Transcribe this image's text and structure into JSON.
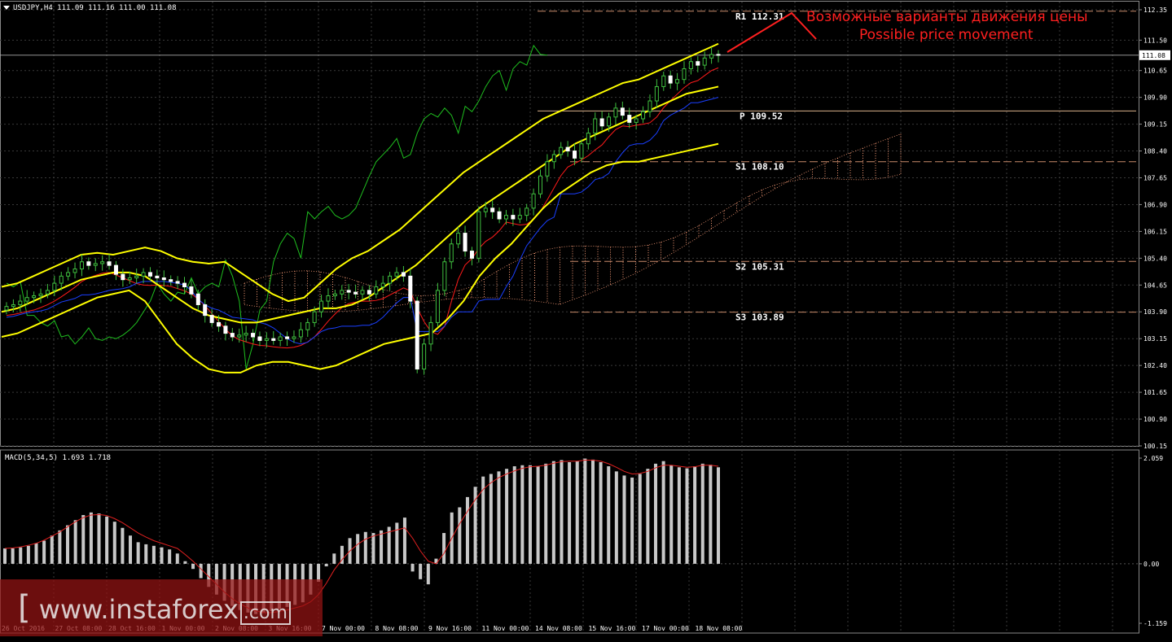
{
  "symbol_header": "USDJPY,H4  111.09 111.16 111.00 111.08",
  "macd_header": "MACD(5,34,5) 1.693 1.718",
  "annotation": {
    "ru": "Возможные варианты движения цены",
    "en": "Possible price movement"
  },
  "watermark": {
    "open": "[",
    "text": "www.instaforex",
    "com": ".com"
  },
  "colors": {
    "background": "#000000",
    "grid": "#3a3a3a",
    "bollinger": "#ffff00",
    "ichimoku_chikou": "#1fbf1f",
    "ichimoku_tenkan": "#ff1a1a",
    "ichimoku_kijun": "#1a3fff",
    "kumo": "#ffa07a",
    "level_line": "#c88a6a",
    "macd_hist": "#c8c8c8",
    "macd_signal": "#e02020",
    "annotation": "#ff2020"
  },
  "chart_data": [
    {
      "type": "candlestick",
      "title": "USDJPY,H4",
      "ohlc_last": {
        "open": 111.09,
        "high": 111.16,
        "low": 111.0,
        "close": 111.08
      },
      "current_price_label": "111.08",
      "y_ticks": [
        "112.35",
        "111.50",
        "110.65",
        "109.90",
        "109.15",
        "108.40",
        "107.65",
        "106.90",
        "106.15",
        "105.40",
        "104.65",
        "103.90",
        "103.15",
        "102.40",
        "101.65",
        "100.90",
        "100.15"
      ],
      "ylim": [
        100.15,
        112.35
      ],
      "x_ticks": [
        "26 Oct 2016",
        "27 Oct 08:00",
        "28 Oct 16:00",
        "1 Nov 00:00",
        "2 Nov 08:00",
        "3 Nov 16:00",
        "7 Nov 00:00",
        "8 Nov 08:00",
        "9 Nov 16:00",
        "11 Nov 00:00",
        "14 Nov 08:00",
        "15 Nov 16:00",
        "17 Nov 00:00",
        "18 Nov 08:00"
      ],
      "pivot_levels": [
        {
          "name": "R1",
          "label": "R1  112.31",
          "value": 112.31
        },
        {
          "name": "P",
          "label": "P  109.52",
          "value": 109.52
        },
        {
          "name": "S1",
          "label": "S1  108.10",
          "value": 108.1
        },
        {
          "name": "S2",
          "label": "S2  105.31",
          "value": 105.31
        },
        {
          "name": "S3",
          "label": "S3  103.89",
          "value": 103.89
        }
      ],
      "close_series": [
        104.05,
        104.1,
        104.2,
        104.3,
        104.35,
        104.4,
        104.5,
        104.7,
        104.9,
        105.0,
        105.1,
        105.3,
        105.2,
        105.25,
        105.3,
        105.2,
        104.95,
        104.8,
        104.85,
        104.9,
        105.0,
        104.9,
        104.85,
        104.8,
        104.75,
        104.7,
        104.6,
        104.4,
        104.1,
        103.8,
        103.6,
        103.5,
        103.3,
        103.2,
        103.25,
        103.3,
        103.2,
        103.1,
        103.15,
        103.1,
        103.2,
        103.15,
        103.2,
        103.4,
        103.6,
        103.9,
        104.2,
        104.35,
        104.4,
        104.5,
        104.45,
        104.4,
        104.5,
        104.4,
        104.6,
        104.7,
        104.9,
        105.0,
        104.9,
        104.2,
        102.3,
        103.0,
        103.6,
        104.5,
        105.3,
        105.8,
        106.1,
        105.6,
        105.4,
        106.7,
        106.8,
        106.7,
        106.5,
        106.6,
        106.5,
        106.6,
        106.8,
        107.2,
        107.7,
        108.1,
        108.3,
        108.5,
        108.4,
        108.2,
        108.6,
        108.9,
        109.3,
        109.1,
        109.35,
        109.6,
        109.4,
        109.2,
        109.3,
        109.5,
        109.8,
        110.2,
        110.5,
        110.3,
        110.4,
        110.7,
        110.9,
        110.8,
        111.0,
        111.1,
        111.08
      ],
      "bollinger_upper": [
        104.6,
        104.7,
        104.9,
        105.1,
        105.3,
        105.5,
        105.55,
        105.5,
        105.6,
        105.7,
        105.6,
        105.4,
        105.3,
        105.25,
        105.3,
        105.0,
        104.7,
        104.4,
        104.2,
        104.3,
        104.7,
        105.1,
        105.4,
        105.6,
        105.9,
        106.2,
        106.6,
        107.0,
        107.4,
        107.8,
        108.1,
        108.4,
        108.7,
        109.0,
        109.3,
        109.5,
        109.7,
        109.9,
        110.1,
        110.3,
        110.4,
        110.6,
        110.8,
        111.0,
        111.2,
        111.4
      ],
      "bollinger_middle": [
        103.9,
        104.0,
        104.2,
        104.4,
        104.6,
        104.8,
        104.9,
        105.0,
        105.0,
        104.9,
        104.6,
        104.3,
        104.0,
        103.8,
        103.7,
        103.6,
        103.6,
        103.7,
        103.8,
        103.9,
        104.0,
        104.0,
        104.1,
        104.3,
        104.6,
        104.9,
        105.2,
        105.6,
        106.0,
        106.4,
        106.8,
        107.1,
        107.4,
        107.7,
        108.0,
        108.3,
        108.6,
        108.8,
        109.0,
        109.2,
        109.4,
        109.6,
        109.8,
        110.0,
        110.1,
        110.2
      ],
      "bollinger_lower": [
        103.2,
        103.3,
        103.5,
        103.7,
        103.9,
        104.1,
        104.3,
        104.4,
        104.5,
        104.2,
        103.6,
        103.0,
        102.6,
        102.3,
        102.2,
        102.2,
        102.4,
        102.5,
        102.5,
        102.4,
        102.3,
        102.4,
        102.6,
        102.8,
        103.0,
        103.1,
        103.2,
        103.3,
        103.7,
        104.2,
        104.9,
        105.4,
        105.8,
        106.3,
        106.8,
        107.2,
        107.5,
        107.8,
        108.0,
        108.1,
        108.1,
        108.2,
        108.3,
        108.4,
        108.5,
        108.6
      ]
    },
    {
      "type": "bar",
      "title": "MACD(5,34,5)",
      "values_header": [
        1.693,
        1.718
      ],
      "y_ticks": [
        "2.059",
        "0.00",
        "-1.159"
      ],
      "ylim": [
        -1.159,
        2.059
      ],
      "histogram": [
        0.3,
        0.3,
        0.32,
        0.35,
        0.4,
        0.45,
        0.55,
        0.65,
        0.75,
        0.85,
        0.95,
        1.0,
        0.98,
        0.92,
        0.82,
        0.7,
        0.55,
        0.42,
        0.38,
        0.35,
        0.32,
        0.28,
        0.2,
        0.05,
        -0.1,
        -0.28,
        -0.45,
        -0.6,
        -0.72,
        -0.82,
        -0.9,
        -0.95,
        -0.98,
        -0.96,
        -0.92,
        -0.88,
        -0.84,
        -0.8,
        -0.75,
        -0.6,
        -0.35,
        -0.05,
        0.2,
        0.35,
        0.5,
        0.58,
        0.62,
        0.6,
        0.65,
        0.72,
        0.8,
        0.9,
        -0.15,
        -0.3,
        -0.4,
        0.1,
        0.6,
        1.0,
        1.1,
        1.3,
        1.5,
        1.7,
        1.75,
        1.8,
        1.85,
        1.9,
        1.92,
        1.92,
        1.9,
        1.95,
        2.0,
        2.02,
        1.98,
        2.0,
        2.05,
        2.03,
        1.98,
        1.9,
        1.8,
        1.72,
        1.68,
        1.75,
        1.85,
        1.95,
        2.0,
        1.92,
        1.88,
        1.86,
        1.9,
        1.95,
        1.93,
        1.88
      ],
      "signal": [
        0.3,
        0.31,
        0.33,
        0.36,
        0.4,
        0.46,
        0.54,
        0.62,
        0.72,
        0.82,
        0.9,
        0.95,
        0.96,
        0.94,
        0.88,
        0.8,
        0.7,
        0.6,
        0.52,
        0.45,
        0.4,
        0.35,
        0.3,
        0.18,
        0.05,
        -0.1,
        -0.25,
        -0.4,
        -0.55,
        -0.68,
        -0.78,
        -0.86,
        -0.92,
        -0.95,
        -0.95,
        -0.93,
        -0.9,
        -0.86,
        -0.82,
        -0.74,
        -0.6,
        -0.38,
        -0.12,
        0.08,
        0.25,
        0.38,
        0.48,
        0.54,
        0.58,
        0.62,
        0.66,
        0.7,
        0.5,
        0.25,
        0.05,
        0.0,
        0.2,
        0.5,
        0.78,
        1.02,
        1.25,
        1.45,
        1.58,
        1.68,
        1.75,
        1.81,
        1.86,
        1.89,
        1.9,
        1.92,
        1.96,
        1.99,
        2.0,
        2.0,
        2.02,
        2.02,
        2.0,
        1.95,
        1.88,
        1.8,
        1.75,
        1.76,
        1.8,
        1.87,
        1.92,
        1.92,
        1.9,
        1.88,
        1.89,
        1.92,
        1.92,
        1.9
      ]
    }
  ]
}
